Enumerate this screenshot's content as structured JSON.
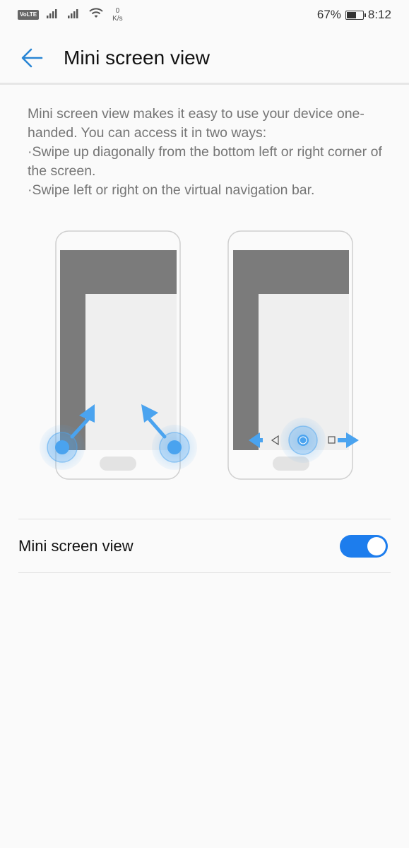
{
  "status_bar": {
    "volte": "VoLTE",
    "data_speed_value": "0",
    "data_speed_unit": "K/s",
    "battery_percent": "67%",
    "battery_level": 0.67,
    "time": "8:12",
    "icons": [
      "signal-icon",
      "signal-icon",
      "wifi-icon",
      "battery-icon"
    ]
  },
  "header": {
    "back_icon": "back-arrow-icon",
    "title": "Mini screen view"
  },
  "description": {
    "lines": [
      "Mini screen view makes it easy to use your device one-handed. You can access it in two ways:",
      "·Swipe up diagonally from the bottom left or right corner of the screen.",
      "·Swipe left or right on the virtual navigation bar."
    ]
  },
  "illustrations": [
    {
      "name": "diagonal-swipe-illustration"
    },
    {
      "name": "navigation-bar-swipe-illustration"
    }
  ],
  "setting": {
    "label": "Mini screen view",
    "enabled": true
  },
  "colors": {
    "accent": "#1d7ded",
    "back_arrow": "#2a86d4",
    "gesture_blue": "#4aa3ef",
    "screen_dark": "#7b7b7b",
    "screen_light": "#efefef"
  }
}
